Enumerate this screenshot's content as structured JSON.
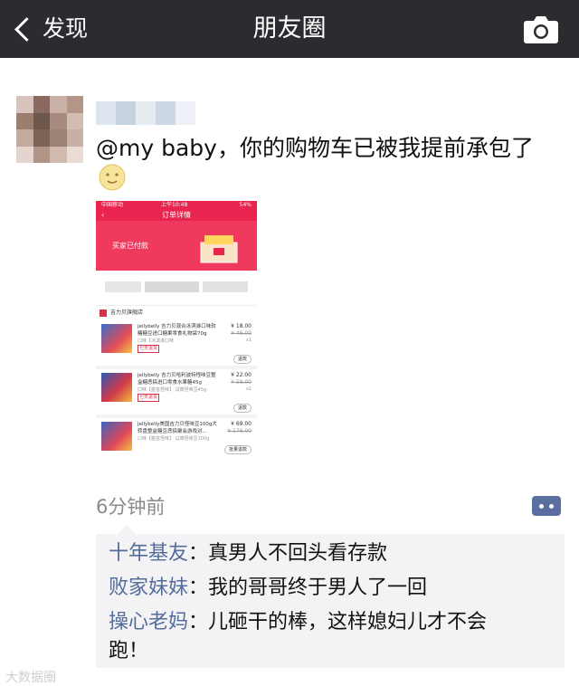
{
  "navbar": {
    "back_label": "发现",
    "title": "朋友圈"
  },
  "post": {
    "text": "@my baby，你的购物车已被我提前承包了",
    "time": "6分钟前"
  },
  "screenshot": {
    "status_carrier": "中国移动",
    "status_time": "上午10:48",
    "status_battery": "54%",
    "header_title": "订单详情",
    "paid_label": "买家已付款",
    "shop_name": "吉力贝旗舰店",
    "items": [
      {
        "desc": "jellybelly 吉力贝混合冰淇淋口味软糖糖豆进口糖果零食礼物袋70g",
        "sub": "口味【冰淇淋口味",
        "tag": "七天退货",
        "price": "¥ 18.00",
        "old_price": "¥ 46.00",
        "qty": "x1",
        "btn": "退款"
      },
      {
        "desc": "jellybelly 吉力贝哈利波特怪味豆整盒糖恶搞进口零食水果糖45g",
        "sub": "口味【整盒怪味】 试菜怪味豆45g",
        "tag": "七天退货",
        "price": "¥ 22.00",
        "old_price": "¥ 58.00",
        "qty": "x1",
        "btn": "退款"
      },
      {
        "desc": "jellybelly美国吉力贝怪味豆100g大转盘整盒糖豆恶搞聚会游戏对...",
        "sub": "口味【整盒怪味】 试菜怪味豆100g",
        "tag": "",
        "price": "¥ 69.00",
        "old_price": "¥ 176.00",
        "qty": "",
        "btn": "批量退款"
      }
    ]
  },
  "comments": [
    {
      "name": "十年基友",
      "text": "：真男人不回头看存款"
    },
    {
      "name": "败家妹妹",
      "text": "：我的哥哥终于男人了一回"
    },
    {
      "name": "操心老妈",
      "text": "：儿砸干的棒，这样媳妇儿才不会跑！"
    }
  ],
  "watermark": "大数据圈",
  "colors": {
    "navbar": "#2b2b30",
    "comment_name": "#536c9c",
    "taobao_red": "#e8244f"
  },
  "icons": [
    "chevron-left-icon",
    "camera-icon",
    "sun-emoji-icon",
    "more-icon"
  ]
}
